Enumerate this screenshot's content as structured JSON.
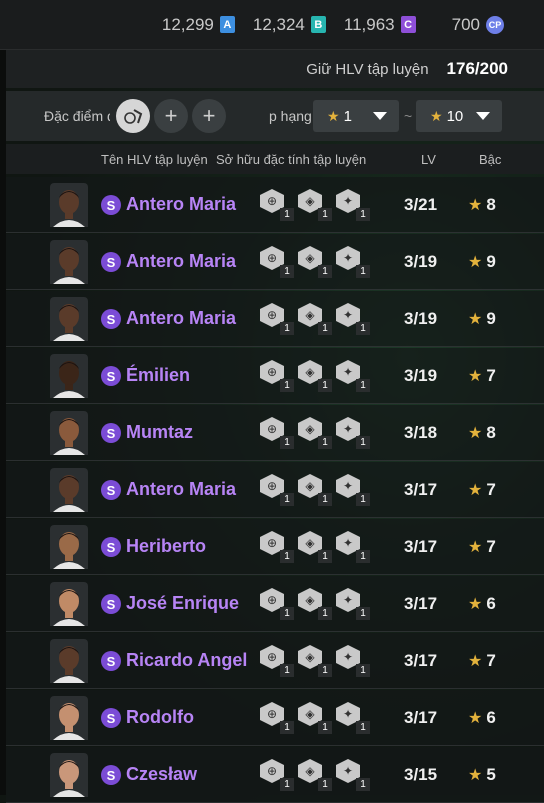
{
  "currencies": [
    {
      "value": "12,299",
      "badge": "A",
      "color": "#3d8fe0"
    },
    {
      "value": "12,324",
      "badge": "B",
      "color": "#27b5b0"
    },
    {
      "value": "11,963",
      "badge": "C",
      "color": "#8e4fd8"
    },
    {
      "value": "700",
      "badge": "CP",
      "color": "#6e7fe8"
    }
  ],
  "coach_hold": {
    "label": "Giữ HLV tập luyện",
    "value": "176/200"
  },
  "filter": {
    "traits_label": "Đặc điểm đ",
    "rank_label": "p hạng",
    "min_rank": "1",
    "max_rank": "10",
    "separator": "~",
    "add_symbol": "+"
  },
  "header": {
    "name": "Tên HLV tập luyện",
    "traits": "Sở hữu đặc tính tập luyện",
    "lv": "LV",
    "rank": "Bậc"
  },
  "rows": [
    {
      "badge": "S",
      "name": "Antero Maria",
      "lv": "3/21",
      "rank": "8",
      "skin": "#5a3b2a",
      "traits": [
        "1",
        "1",
        "1"
      ]
    },
    {
      "badge": "S",
      "name": "Antero Maria",
      "lv": "3/19",
      "rank": "9",
      "skin": "#5a3b2a",
      "traits": [
        "1",
        "1",
        "1"
      ]
    },
    {
      "badge": "S",
      "name": "Antero Maria",
      "lv": "3/19",
      "rank": "9",
      "skin": "#5a3b2a",
      "traits": [
        "1",
        "1",
        "1"
      ]
    },
    {
      "badge": "S",
      "name": "Émilien",
      "lv": "3/19",
      "rank": "7",
      "skin": "#3b2518",
      "traits": [
        "1",
        "1",
        "1"
      ]
    },
    {
      "badge": "S",
      "name": "Mumtaz",
      "lv": "3/18",
      "rank": "8",
      "skin": "#8a5a3c",
      "traits": [
        "1",
        "1",
        "1"
      ]
    },
    {
      "badge": "S",
      "name": "Antero Maria",
      "lv": "3/17",
      "rank": "7",
      "skin": "#5a3b2a",
      "traits": [
        "1",
        "1",
        "1"
      ]
    },
    {
      "badge": "S",
      "name": "Heriberto",
      "lv": "3/17",
      "rank": "7",
      "skin": "#9a6a48",
      "traits": [
        "1",
        "1",
        "1"
      ]
    },
    {
      "badge": "S",
      "name": "José Enrique",
      "lv": "3/17",
      "rank": "6",
      "skin": "#c08a66",
      "traits": [
        "1",
        "1",
        "1"
      ]
    },
    {
      "badge": "S",
      "name": "Ricardo Angel",
      "lv": "3/17",
      "rank": "7",
      "skin": "#5a3b2a",
      "traits": [
        "1",
        "1",
        "1"
      ]
    },
    {
      "badge": "S",
      "name": "Rodolfo",
      "lv": "3/17",
      "rank": "6",
      "skin": "#c49070",
      "traits": [
        "1",
        "1",
        "1"
      ]
    },
    {
      "badge": "S",
      "name": "Czesław",
      "lv": "3/15",
      "rank": "5",
      "skin": "#c9977a",
      "traits": [
        "1",
        "1",
        "1"
      ]
    }
  ]
}
